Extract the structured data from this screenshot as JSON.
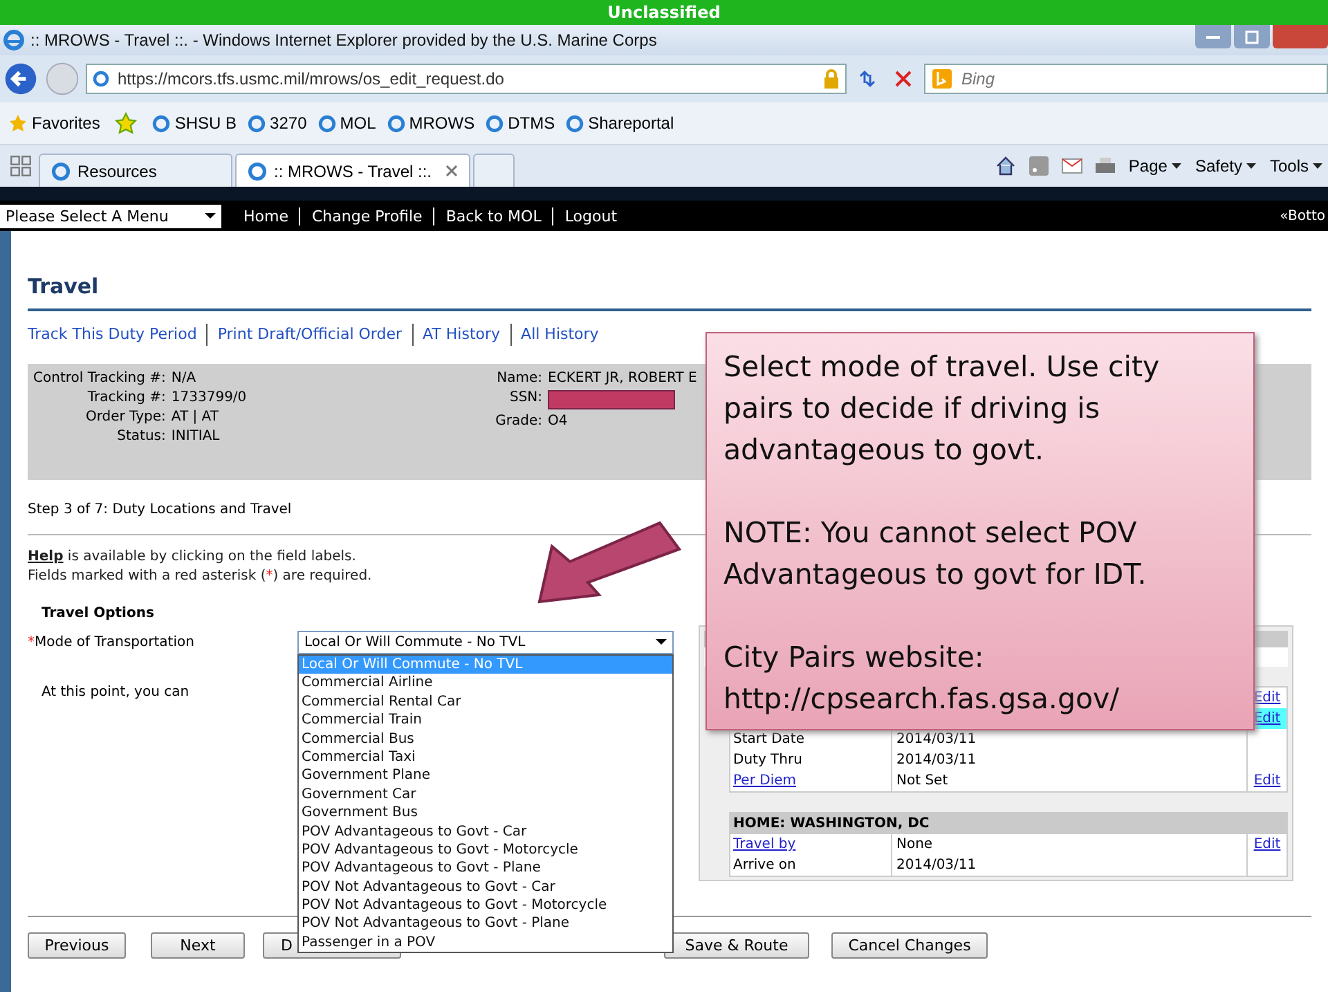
{
  "banner": "Unclassified",
  "browser": {
    "title": ":: MROWS - Travel ::. - Windows Internet Explorer provided by the U.S. Marine Corps",
    "address": "https://mcors.tfs.usmc.mil/mrows/os_edit_request.do",
    "search_placeholder": "Bing",
    "favorites_label": "Favorites",
    "favorites": [
      "SHSU B",
      "3270",
      "MOL",
      "MROWS",
      "DTMS",
      "Shareportal"
    ],
    "tabs": [
      {
        "label": "Resources",
        "selected": false
      },
      {
        "label": ":: MROWS - Travel ::.",
        "selected": true
      }
    ],
    "menus": [
      "Page",
      "Safety",
      "Tools"
    ]
  },
  "nav": {
    "menu_select": "Please Select A Menu",
    "links": [
      "Home",
      "Change Profile",
      "Back to MOL",
      "Logout"
    ],
    "right": "«Botto"
  },
  "page": {
    "heading": "Travel",
    "links": [
      "Track This Duty Period",
      "Print Draft/Official Order",
      "AT History",
      "All History"
    ],
    "info_left": [
      {
        "label": "Control Tracking #:",
        "value": "N/A"
      },
      {
        "label": "Tracking #:",
        "value": "1733799/0"
      },
      {
        "label": "Order Type:",
        "value": "AT | AT"
      },
      {
        "label": "Status:",
        "value": "INITIAL"
      }
    ],
    "info_right": [
      {
        "label": "Name:",
        "value": "ECKERT JR, ROBERT E",
        "redacted": false
      },
      {
        "label": "SSN:",
        "redacted": true
      },
      {
        "label": "Grade:",
        "value": "O4",
        "redacted": false
      }
    ],
    "step": "Step 3 of 7: Duty Locations and Travel",
    "help_link": "Help",
    "help_text": " is available by clicking on the field labels.",
    "required_before": "Fields marked with a red asterisk (",
    "required_mark": "*",
    "required_after": ") are required.",
    "travel_options": {
      "title": "Travel Options",
      "field_label": "Mode of Transportation",
      "required": true,
      "value": "Local Or Will Commute - No TVL",
      "options": [
        {
          "label": "Local Or Will Commute - No TVL",
          "selected": true
        },
        {
          "label": "Commercial Airline",
          "selected": false
        },
        {
          "label": "Commercial Rental Car",
          "selected": false
        },
        {
          "label": "Commercial Train",
          "selected": false
        },
        {
          "label": "Commercial Bus",
          "selected": false
        },
        {
          "label": "Commercial Taxi",
          "selected": false
        },
        {
          "label": "Government Plane",
          "selected": false
        },
        {
          "label": "Government Car",
          "selected": false
        },
        {
          "label": "Government Bus",
          "selected": false
        },
        {
          "label": "POV Advantageous to Govt - Car",
          "selected": false
        },
        {
          "label": "POV Advantageous to Govt - Motorcycle",
          "selected": false
        },
        {
          "label": "POV Advantageous to Govt - Plane",
          "selected": false
        },
        {
          "label": "POV Not Advantageous to Govt - Car",
          "selected": false
        },
        {
          "label": "POV Not Advantageous to Govt - Motorcycle",
          "selected": false
        },
        {
          "label": "POV Not Advantageous to Govt - Plane",
          "selected": false
        },
        {
          "label": "Passenger in a POV",
          "selected": false
        }
      ],
      "note": "At this point, you can"
    },
    "duty_rows": [
      {
        "edit": "Edit",
        "highlight": false
      },
      {
        "edit": "Edit",
        "highlight": true
      },
      {
        "label": "Start Date",
        "value": "2014/03/11",
        "link": false,
        "highlight": false
      },
      {
        "label": "Duty Thru",
        "value": "2014/03/11",
        "link": false,
        "highlight": false
      },
      {
        "label": "Per Diem",
        "value": "Not Set",
        "edit": "Edit",
        "link": true,
        "highlight": false
      }
    ],
    "home_header": "HOME: WASHINGTON, DC",
    "home_rows": [
      {
        "label": "Travel by",
        "value": "None",
        "edit": "Edit",
        "link": true,
        "highlight": false
      },
      {
        "label": "Arrive on",
        "value": "2014/03/11",
        "link": false,
        "highlight": false
      }
    ],
    "buttons": [
      "Previous",
      "Next",
      "D",
      "Save & Route",
      "Cancel Changes"
    ]
  },
  "callout": {
    "paragraphs": [
      [
        "Select mode of travel. Use city",
        "pairs to decide if driving is",
        "advantageous to govt."
      ],
      [
        "NOTE: You cannot select POV",
        "Advantageous to govt for IDT."
      ],
      [
        "City Pairs website:",
        "http://cpsearch.fas.gsa.gov/"
      ]
    ]
  }
}
